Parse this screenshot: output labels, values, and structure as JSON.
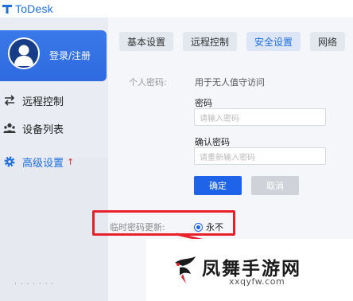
{
  "app": {
    "title": "ToDesk"
  },
  "sidebar": {
    "login_label": "登录/注册",
    "items": [
      {
        "label": "远程控制",
        "icon": "swap-arrows-icon"
      },
      {
        "label": "设备列表",
        "icon": "users-icon"
      },
      {
        "label": "高级设置",
        "icon": "gear-icon",
        "badge_icon": "upgrade-arrow-icon"
      }
    ],
    "active_color": "#1f6fe0"
  },
  "tabs": [
    {
      "label": "基本设置"
    },
    {
      "label": "远程控制"
    },
    {
      "label": "安全设置",
      "active": true
    },
    {
      "label": "网络"
    }
  ],
  "security": {
    "personal_password_label": "个人密码:",
    "personal_password_value": "用于无人值守访问",
    "password_title": "密码",
    "password_placeholder": "请输入密码",
    "confirm_title": "确认密码",
    "confirm_placeholder": "请重新输入密码",
    "confirm_button": "确定",
    "cancel_button": "取消",
    "temp_password_label": "临时密码更新:",
    "temp_password_option": "永不"
  },
  "watermark": {
    "title": "凤舞手游网",
    "url": "xxqyfw.com"
  },
  "colors": {
    "accent": "#1f63e8",
    "highlight": "#e8202c",
    "login_card": "#2e6ae0"
  }
}
